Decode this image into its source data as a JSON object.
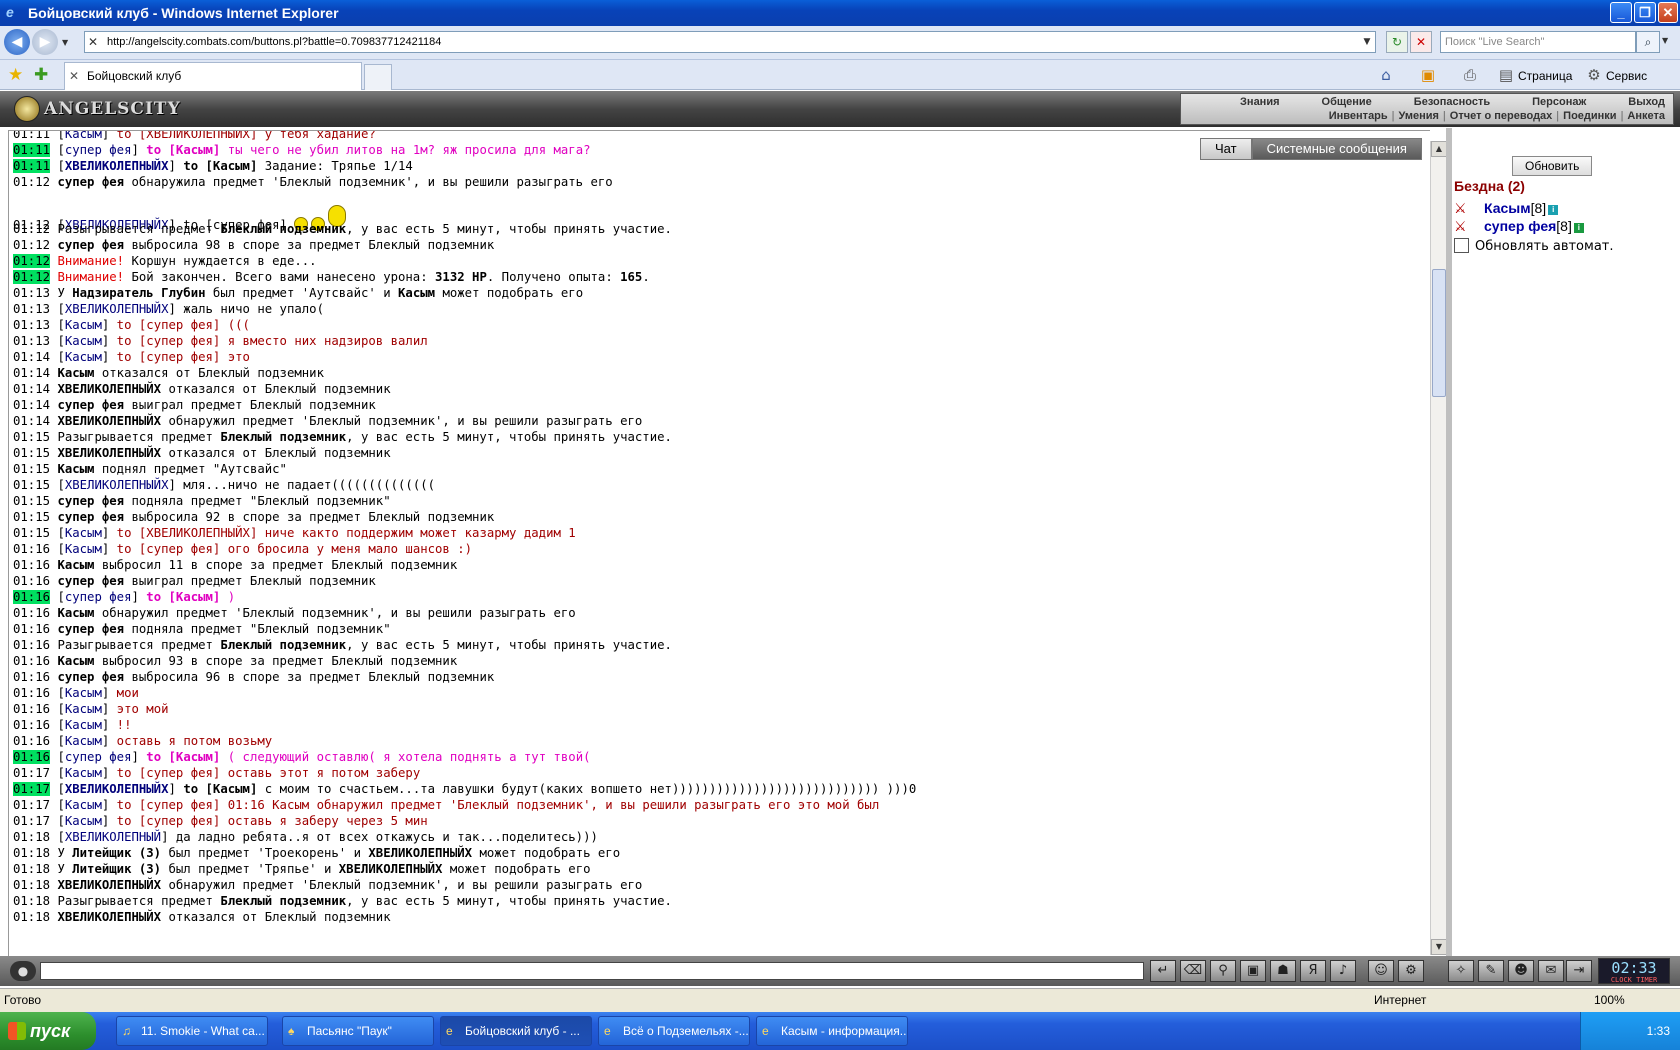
{
  "window": {
    "title": "Бойцовский клуб - Windows Internet Explorer",
    "min_icon": "minimize-icon",
    "max_icon": "maximize-icon",
    "close_icon": "close-icon"
  },
  "address": {
    "url": "http://angelscity.combats.com/buttons.pl?battle=0.709837712421184",
    "search_placeholder": "Поиск \"Live Search\""
  },
  "tabs": {
    "active_label": "Бойцовский клуб",
    "toolbar": {
      "page": "Страница",
      "tools": "Сервис"
    }
  },
  "game": {
    "logo_text": "ANGELSCITY",
    "menu_top": [
      "Знания",
      "Общение",
      "Безопасность",
      "Персонаж",
      "Выход"
    ],
    "menu_bottom": [
      "Инвентарь",
      "Умения",
      "Отчет о переводах",
      "Поединки",
      "Анкета"
    ]
  },
  "chat": {
    "tab_chat": "Чат",
    "tab_system": "Системные сообщения",
    "lines": [
      {
        "t": "01:11",
        "n": "Касым",
        "txt": "to [ХВЕЛИКОЛЕПНЫЙХ] у тебя хадание?",
        "k": "private"
      },
      {
        "t": "01:11",
        "hl": true,
        "n": "супер фея",
        "txt": "to [Касым] ты чего не убил литов на 1м? яж просила для мага?",
        "k": "mag"
      },
      {
        "t": "01:11",
        "hl": true,
        "n": "ХВЕЛИКОЛЕПНЫЙХ",
        "txt": "to [Касым] Задание: Тряпье 1/14",
        "k": "bold-to"
      },
      {
        "t": "01:12",
        "n": "супер фея",
        "txt": "обнаружила предмет 'Блеклый подземник', и вы решили разыграть его",
        "k": "sys-name"
      },
      {
        "t": "01:12",
        "n": "ХВЕЛИКОЛЕПНЫЙХ",
        "txt": "to [супер фея]",
        "k": "smiley"
      },
      {
        "t": "01:12",
        "txt": "Разыгрывается предмет <b>Блеклый подземник</b>, у вас есть 5 минут, чтобы принять участие.",
        "k": "raw"
      },
      {
        "t": "01:12",
        "n": "супер фея",
        "txt": "выбросила 98 в споре за предмет Блеклый подземник",
        "k": "sys-name"
      },
      {
        "t": "01:12",
        "hl": true,
        "warn": "Внимание!",
        "txt": "Коршун нуждается в еде...",
        "k": "warn"
      },
      {
        "t": "01:12",
        "hl": true,
        "warn": "Внимание!",
        "txt": "Бой закончен. Всего вами нанесено урона: <b>3132 HP</b>. Получено опыта: <b>165</b>.",
        "k": "warn"
      },
      {
        "t": "01:13",
        "txt": "У <b>Надзиратель Глубин</b> был предмет 'Аутсвайс' и <b>Касым</b> может подобрать его",
        "k": "raw"
      },
      {
        "t": "01:13",
        "n": "ХВЕЛИКОЛЕПНЫЙХ",
        "txt": "жаль ничо не упало(",
        "k": "public"
      },
      {
        "t": "01:13",
        "n": "Касым",
        "txt": "to [супер фея] (((",
        "k": "private"
      },
      {
        "t": "01:13",
        "n": "Касым",
        "txt": "to [супер фея] я вместо них надзиров валил",
        "k": "private"
      },
      {
        "t": "01:14",
        "n": "Касым",
        "txt": "to [супер фея] это",
        "k": "private"
      },
      {
        "t": "01:14",
        "n": "Касым",
        "txt": "отказался от Блеклый подземник",
        "k": "sys-name"
      },
      {
        "t": "01:14",
        "n": "ХВЕЛИКОЛЕПНЫЙХ",
        "txt": "отказался от Блеклый подземник",
        "k": "sys-name"
      },
      {
        "t": "01:14",
        "n": "супер фея",
        "txt": "выиграл предмет Блеклый подземник",
        "k": "sys-name"
      },
      {
        "t": "01:14",
        "n": "ХВЕЛИКОЛЕПНЫЙХ",
        "txt": "обнаружил предмет 'Блеклый подземник', и вы решили разыграть его",
        "k": "sys-name"
      },
      {
        "t": "01:15",
        "txt": "Разыгрывается предмет <b>Блеклый подземник</b>, у вас есть 5 минут, чтобы принять участие.",
        "k": "raw"
      },
      {
        "t": "01:15",
        "n": "ХВЕЛИКОЛЕПНЫЙХ",
        "txt": "отказался от Блеклый подземник",
        "k": "sys-name"
      },
      {
        "t": "01:15",
        "n": "Касым",
        "txt": "поднял предмет \"Аутсвайс\"",
        "k": "sys-name"
      },
      {
        "t": "01:15",
        "n": "ХВЕЛИКОЛЕПНЫЙХ",
        "txt": "мля...ничо не падает((((((((((((((",
        "k": "public"
      },
      {
        "t": "01:15",
        "n": "супер фея",
        "txt": "подняла предмет \"Блеклый подземник\"",
        "k": "sys-name"
      },
      {
        "t": "01:15",
        "n": "супер фея",
        "txt": "выбросила 92 в споре за предмет Блеклый подземник",
        "k": "sys-name"
      },
      {
        "t": "01:15",
        "n": "Касым",
        "txt": "to [ХВЕЛИКОЛЕПНЫЙХ] ниче както поддержим может казарму дадим 1",
        "k": "private"
      },
      {
        "t": "01:16",
        "n": "Касым",
        "txt": "to [супер фея] ого бросила у меня мало шансов :)",
        "k": "private"
      },
      {
        "t": "01:16",
        "n": "Касым",
        "txt": "выбросил 11 в споре за предмет Блеклый подземник",
        "k": "sys-name"
      },
      {
        "t": "01:16",
        "n": "супер фея",
        "txt": "выиграл предмет Блеклый подземник",
        "k": "sys-name"
      },
      {
        "t": "01:16",
        "hl": true,
        "n": "супер фея",
        "txt": "to [Касым] )",
        "k": "mag"
      },
      {
        "t": "01:16",
        "n": "Касым",
        "txt": "обнаружил предмет 'Блеклый подземник', и вы решили разыграть его",
        "k": "sys-name"
      },
      {
        "t": "01:16",
        "n": "супер фея",
        "txt": "подняла предмет \"Блеклый подземник\"",
        "k": "sys-name"
      },
      {
        "t": "01:16",
        "txt": "Разыгрывается предмет <b>Блеклый подземник</b>, у вас есть 5 минут, чтобы принять участие.",
        "k": "raw"
      },
      {
        "t": "01:16",
        "n": "Касым",
        "txt": "выбросил 93 в споре за предмет Блеклый подземник",
        "k": "sys-name"
      },
      {
        "t": "01:16",
        "n": "супер фея",
        "txt": "выбросила 96 в споре за предмет Блеклый подземник",
        "k": "sys-name"
      },
      {
        "t": "01:16",
        "n": "Касым",
        "txt": "мои",
        "k": "public-red"
      },
      {
        "t": "01:16",
        "n": "Касым",
        "txt": "это мой",
        "k": "public-red"
      },
      {
        "t": "01:16",
        "n": "Касым",
        "txt": "!!",
        "k": "public-red"
      },
      {
        "t": "01:16",
        "n": "Касым",
        "txt": "оставь я потом возьму",
        "k": "public-red"
      },
      {
        "t": "01:16",
        "hl": true,
        "n": "супер фея",
        "txt": "to [Касым] ( следующий оставлю( я хотела поднять а тут твой(",
        "k": "mag"
      },
      {
        "t": "01:17",
        "n": "Касым",
        "txt": "to [супер фея] оставь этот я потом заберу",
        "k": "private"
      },
      {
        "t": "01:17",
        "hl": true,
        "n": "ХВЕЛИКОЛЕПНЫЙХ",
        "txt": "to [Касым] с моим то счастьем...та лавушки будут(каких вопшето нет)))))))))))))))))))))))))))) )))0",
        "k": "bold-to-plain"
      },
      {
        "t": "01:17",
        "n": "Касым",
        "txt": "to [супер фея] 01:16 Касым обнаружил предмет 'Блеклый подземник', и вы решили разыграть его это мой был",
        "k": "private"
      },
      {
        "t": "01:17",
        "n": "Касым",
        "txt": "to [супер фея] оставь я заберу через 5 мин",
        "k": "private"
      },
      {
        "t": "01:18",
        "n": "ХВЕЛИКОЛЕПНЫЙ",
        "txt": "да ладно ребята..я от всех откажусь и так...поделитесь)))",
        "k": "public"
      },
      {
        "t": "01:18",
        "txt": "У <b>Литейщик (3)</b> был предмет 'Троекорень' и <b>ХВЕЛИКОЛЕПНЫЙХ</b> может подобрать его",
        "k": "raw"
      },
      {
        "t": "01:18",
        "txt": "У <b>Литейщик (3)</b> был предмет 'Тряпье' и <b>ХВЕЛИКОЛЕПНЫЙХ</b> может подобрать его",
        "k": "raw"
      },
      {
        "t": "01:18",
        "n": "ХВЕЛИКОЛЕПНЫЙХ",
        "txt": "обнаружил предмет 'Блеклый подземник', и вы решили разыграть его",
        "k": "sys-name"
      },
      {
        "t": "01:18",
        "txt": "Разыгрывается предмет <b>Блеклый подземник</b>, у вас есть 5 минут, чтобы принять участие.",
        "k": "raw"
      },
      {
        "t": "01:18",
        "n": "ХВЕЛИКОЛЕПНЫЙХ",
        "txt": "отказался от Блеклый подземник",
        "k": "sys-name"
      }
    ]
  },
  "right": {
    "refresh_label": "Обновить",
    "location": "Бездна (2)",
    "players": [
      {
        "name": "Касым",
        "level": "[8]"
      },
      {
        "name": "супер фея",
        "level": "[8]"
      }
    ],
    "auto_refresh_label": "Обновлять автомат."
  },
  "bottom": {
    "clock": "02:33",
    "clock_sub": "CLOCK  TIMER"
  },
  "status": {
    "ready": "Готово",
    "zone": "Интернет",
    "zoom": "100%"
  },
  "taskbar": {
    "start": "пуск",
    "items": [
      "11. Smokie - What ca...",
      "Пасьянс \"Паук\"",
      "Бойцовский клуб - ...",
      "Всё о Подземельях -...",
      "Касым - информация..."
    ],
    "time": "1:33"
  }
}
